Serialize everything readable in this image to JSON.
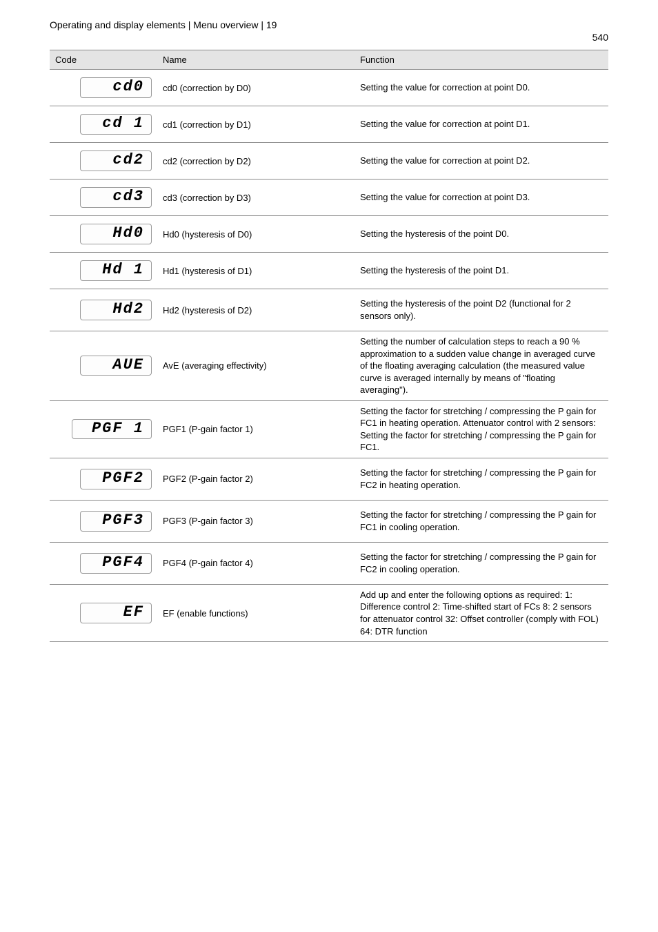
{
  "header": {
    "breadcrumb": "Operating and display elements | Menu overview | 19",
    "page_number": "540"
  },
  "columns": {
    "code": "Code",
    "name": "Name",
    "function": "Function"
  },
  "rows": [
    {
      "lcd": "cd0",
      "name": "cd0 (correction by D0)",
      "func": "Setting the value for correction at point D0.",
      "h": "short"
    },
    {
      "lcd": "cd 1",
      "name": "cd1 (correction by D1)",
      "func": "Setting the value for correction at point D1.",
      "h": "short"
    },
    {
      "lcd": "cd2",
      "name": "cd2 (correction by D2)",
      "func": "Setting the value for correction at point D2.",
      "h": "short"
    },
    {
      "lcd": "cd3",
      "name": "cd3 (correction by D3)",
      "func": "Setting the value for correction at point D3.",
      "h": "short"
    },
    {
      "lcd": "Hd0",
      "name": "Hd0 (hysteresis of D0)",
      "func": "Setting the hysteresis of the point D0.",
      "h": "short"
    },
    {
      "lcd": "Hd 1",
      "name": "Hd1 (hysteresis of D1)",
      "func": "Setting the hysteresis of the point D1.",
      "h": "short"
    },
    {
      "lcd": "Hd2",
      "name": "Hd2 (hysteresis of D2)",
      "func": "Setting the hysteresis of the point D2 (functional for 2 sensors only).",
      "h": "med"
    },
    {
      "lcd": "AUE",
      "name": "AvE (averaging effectivity)",
      "func": "Setting the number of calculation steps to reach a 90 % approximation to a sudden value change in averaged curve of the floating averaging calculation (the measured value curve is averaged internally by means of \"floating averaging\").",
      "h": "tall"
    },
    {
      "lcd": "PGF 1",
      "name": "PGF1 (P-gain factor 1)",
      "func": "Setting the factor for stretching / compressing the P gain for FC1 in heating operation. Attenuator control with 2 sensors: Setting the factor for stretching / compressing the P gain for FC1.",
      "h": "tall"
    },
    {
      "lcd": "PGF2",
      "name": "PGF2 (P-gain factor 2)",
      "func": "Setting the factor for stretching / compressing the P gain for FC2 in heating operation.",
      "h": "med"
    },
    {
      "lcd": "PGF3",
      "name": "PGF3 (P-gain factor 3)",
      "func": "Setting the factor for stretching / compressing the P gain for FC1 in cooling operation.",
      "h": "med"
    },
    {
      "lcd": "PGF4",
      "name": "PGF4 (P-gain factor 4)",
      "func": "Setting the factor for stretching / compressing the P gain for FC2 in cooling operation.",
      "h": "med"
    },
    {
      "lcd": "EF",
      "name": "EF (enable functions)",
      "func": "Add up and enter the following options as required: 1: Difference control 2: Time-shifted start of FCs 8: 2 sensors for attenuator control 32: Offset controller (comply with FOL) 64: DTR function",
      "h": "tall"
    }
  ]
}
